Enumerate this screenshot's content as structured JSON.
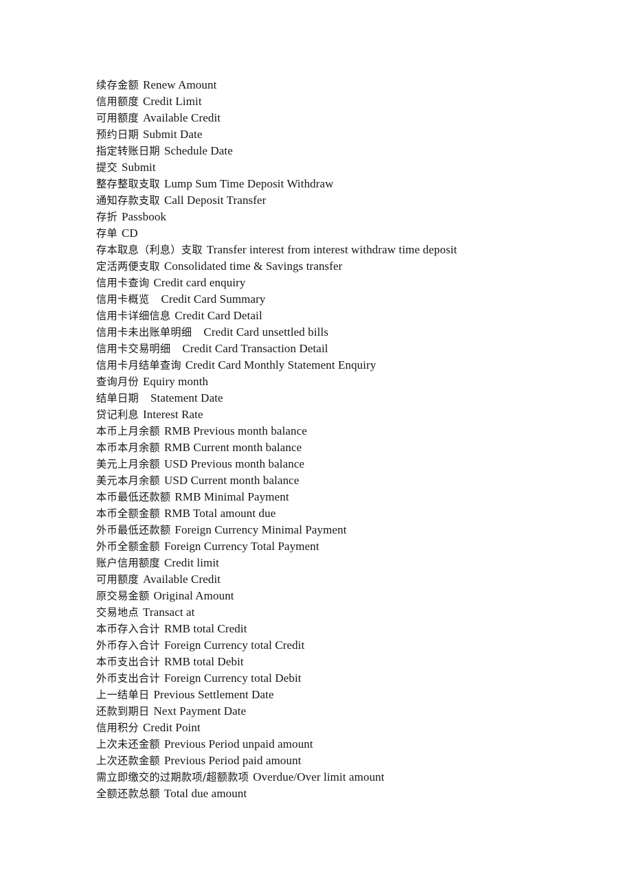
{
  "document": {
    "type": "bilingual-glossary",
    "language_pair": "Chinese-English",
    "line_count": 43,
    "entries": [
      {
        "zh": "续存金额",
        "en": "Renew Amount",
        "gap": "small"
      },
      {
        "zh": "信用额度",
        "en": "Credit Limit",
        "gap": "small"
      },
      {
        "zh": "可用额度",
        "en": "Available Credit",
        "gap": "small"
      },
      {
        "zh": "预约日期",
        "en": "Submit Date",
        "gap": "small"
      },
      {
        "zh": "指定转账日期",
        "en": "Schedule Date",
        "gap": "small"
      },
      {
        "zh": "提交",
        "en": "Submit",
        "gap": "small"
      },
      {
        "zh": "整存整取支取",
        "en": "Lump Sum Time Deposit Withdraw",
        "gap": "small"
      },
      {
        "zh": "通知存款支取",
        "en": "Call Deposit Transfer",
        "gap": "small"
      },
      {
        "zh": "存折",
        "en": "Passbook",
        "gap": "small"
      },
      {
        "zh": "存单",
        "en": "CD",
        "gap": "small"
      },
      {
        "zh": "存本取息（利息）支取",
        "en": "Transfer interest from interest withdraw time deposit",
        "gap": "small"
      },
      {
        "zh": "定活两便支取",
        "en": "Consolidated time & Savings transfer",
        "gap": "small"
      },
      {
        "zh": "信用卡查询",
        "en": "Credit card enquiry",
        "gap": "small"
      },
      {
        "zh": "信用卡概览",
        "en": "Credit Card Summary",
        "gap": "large"
      },
      {
        "zh": "信用卡详细信息",
        "en": "Credit Card Detail",
        "gap": "small"
      },
      {
        "zh": "信用卡未出账单明细",
        "en": "Credit Card unsettled bills",
        "gap": "large"
      },
      {
        "zh": "信用卡交易明细",
        "en": "Credit Card Transaction Detail",
        "gap": "large"
      },
      {
        "zh": "信用卡月结单查询",
        "en": "Credit Card Monthly Statement Enquiry",
        "gap": "small"
      },
      {
        "zh": "查询月份",
        "en": "Equiry month",
        "gap": "small"
      },
      {
        "zh": "结单日期",
        "en": "Statement Date",
        "gap": "large"
      },
      {
        "zh": "贷记利息",
        "en": "Interest Rate",
        "gap": "small"
      },
      {
        "zh": "本币上月余额",
        "en": "RMB Previous month balance",
        "gap": "small"
      },
      {
        "zh": "本币本月余额",
        "en": "RMB Current month balance",
        "gap": "small"
      },
      {
        "zh": "美元上月余额",
        "en": "USD Previous month balance",
        "gap": "small"
      },
      {
        "zh": "美元本月余额",
        "en": "USD Current month balance",
        "gap": "small"
      },
      {
        "zh": "本币最低还款额",
        "en": "RMB Minimal Payment",
        "gap": "small"
      },
      {
        "zh": "本币全额金额",
        "en": "RMB Total amount due",
        "gap": "small"
      },
      {
        "zh": "外币最低还款额",
        "en": "Foreign Currency Minimal Payment",
        "gap": "small"
      },
      {
        "zh": "外币全额金额",
        "en": "Foreign Currency Total Payment",
        "gap": "small"
      },
      {
        "zh": "账户信用额度",
        "en": "Credit limit",
        "gap": "small"
      },
      {
        "zh": "可用额度",
        "en": "Available Credit",
        "gap": "small"
      },
      {
        "zh": "原交易金额",
        "en": "Original Amount",
        "gap": "small"
      },
      {
        "zh": "交易地点",
        "en": "Transact at",
        "gap": "small"
      },
      {
        "zh": "本币存入合计",
        "en": "RMB total Credit",
        "gap": "small"
      },
      {
        "zh": "外币存入合计",
        "en": "Foreign Currency total Credit",
        "gap": "small"
      },
      {
        "zh": "本币支出合计",
        "en": "RMB total Debit",
        "gap": "small"
      },
      {
        "zh": "外币支出合计",
        "en": "Foreign Currency total Debit",
        "gap": "small"
      },
      {
        "zh": "上一结单日",
        "en": "Previous Settlement Date",
        "gap": "small"
      },
      {
        "zh": "还款到期日",
        "en": "Next Payment Date",
        "gap": "small"
      },
      {
        "zh": "信用积分",
        "en": "Credit Point",
        "gap": "small"
      },
      {
        "zh": "上次未还金额",
        "en": "Previous Period unpaid amount",
        "gap": "small"
      },
      {
        "zh": "上次还款金额",
        "en": "Previous Period paid amount",
        "gap": "small"
      },
      {
        "zh": "需立即缴交的过期款项/超额款项",
        "en": "Overdue/Over limit amount",
        "gap": "small"
      },
      {
        "zh": "全额还款总额",
        "en": "Total due amount",
        "gap": "small"
      }
    ]
  }
}
